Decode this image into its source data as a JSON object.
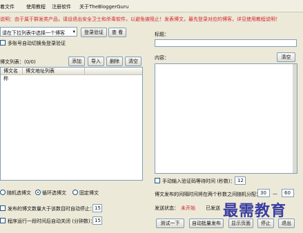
{
  "menu": [
    "着文件",
    "使用教程",
    "注册软件",
    "关于TheBloggerGuru"
  ],
  "notice": "说明：由于属于群发类产品，请设退出安全卫士和杀毒软件，以避免被阻止！发表博文，最先登录对应的博客，详见使用教程说明！",
  "login": {
    "select_value": "请在下拉列表中选择一个博客",
    "login_button": "登录验证",
    "view_button": "查 看",
    "auto_switch_label": "多账号自动切换免登录验证"
  },
  "list": {
    "title": "博文列表：(0/0)",
    "add": "添加",
    "import": "导入",
    "delete": "删除",
    "clear": "清空",
    "columns": [
      "博文名称",
      "博文地址列表"
    ]
  },
  "editor": {
    "title_label": "标题：",
    "content_label": "内容：",
    "clear_button": "清空"
  },
  "options": {
    "radio_random": "随机选博文",
    "radio_cycle": "循环选博文",
    "radio_fixed": "固定博文",
    "selected_radio": "radio_cycle",
    "stop_label": "发布的博文数量大于该数目时自动停止：",
    "stop_value": "15",
    "shutdown_label": "程序运行一段时间后自动关闭 (分钟数)：",
    "shutdown_value": "15",
    "captcha_label": "手动输入验证码等待时间 (秒数)：",
    "captcha_value": "12",
    "interval_label": "博文发布的间隔时间将在两个秒数之间随机分配：",
    "interval_min": "30",
    "interval_dash": "—",
    "interval_max": "60"
  },
  "status": {
    "state_label": "发送状态：",
    "state_value": "未开始",
    "sent_label": "已发送"
  },
  "actions": {
    "test": "测试一下",
    "auto_publish": "自动批量发布",
    "show_page": "显示页面",
    "stop": "停止",
    "exit": "退出"
  },
  "watermark": "最需教育",
  "colors": {
    "notice": "#d4232c",
    "status": "#d4232c",
    "watermark": "#2a2f9c"
  }
}
